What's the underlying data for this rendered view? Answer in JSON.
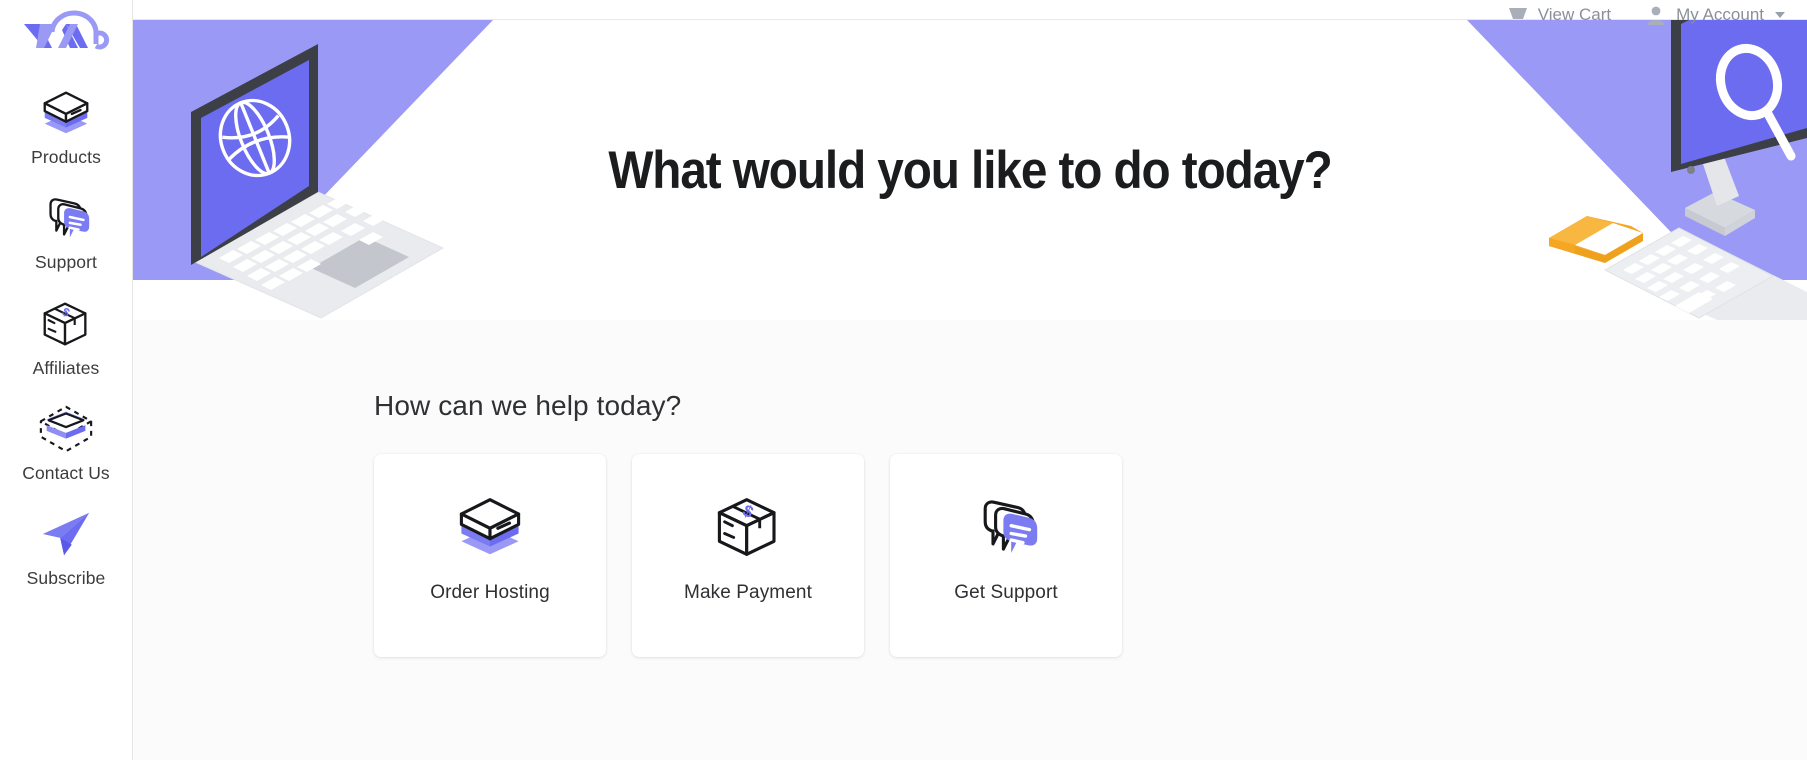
{
  "colors": {
    "accent": "#6C6CF0",
    "accent_light": "#9a9af6",
    "accent_pale": "#8f8ff2",
    "ink": "#1b1c1e",
    "muted": "#8b8f98",
    "page_bg": "#fbfbfb",
    "card_bg": "#ffffff",
    "orange": "#f5a623",
    "orange_dark": "#efa01c"
  },
  "sidebar": {
    "logo": {
      "name": "vectorapps-logo",
      "alt": "VA"
    },
    "items": [
      {
        "label": "Products",
        "icon": "server-box-icon"
      },
      {
        "label": "Support",
        "icon": "chat-bubbles-icon"
      },
      {
        "label": "Affiliates",
        "icon": "package-dollar-icon"
      },
      {
        "label": "Contact Us",
        "icon": "envelope-dashed-icon"
      },
      {
        "label": "Subscribe",
        "icon": "paper-plane-icon"
      }
    ]
  },
  "topbar": {
    "links": [
      {
        "label": "View Cart",
        "icon": "cart-icon",
        "has_caret": false
      },
      {
        "label": "My Account",
        "icon": "person-icon",
        "has_caret": true
      }
    ]
  },
  "hero": {
    "title": "What would you like to do today?",
    "art_left": "isometric-laptop-globe-illustration",
    "art_right": "isometric-desktop-search-illustration"
  },
  "main": {
    "section_title": "How can we help today?",
    "cards": [
      {
        "label": "Order Hosting",
        "icon": "server-box-icon"
      },
      {
        "label": "Make Payment",
        "icon": "package-dollar-icon"
      },
      {
        "label": "Get Support",
        "icon": "chat-bubbles-icon"
      }
    ]
  }
}
